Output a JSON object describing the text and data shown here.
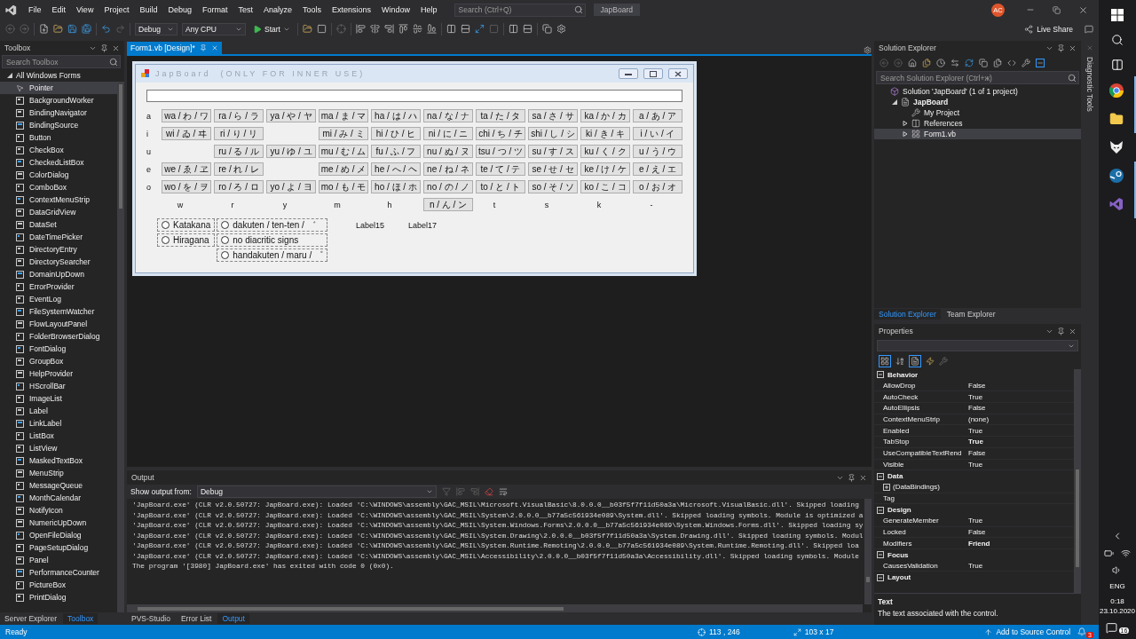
{
  "menu_bar": {
    "items": [
      "File",
      "Edit",
      "View",
      "Project",
      "Build",
      "Debug",
      "Format",
      "Test",
      "Analyze",
      "Tools",
      "Extensions",
      "Window",
      "Help"
    ],
    "search": {
      "placeholder": "Search (Ctrl+Q)"
    },
    "solution_name": "JapBoard",
    "avatar": "AC"
  },
  "toolbar": {
    "configuration": "Debug",
    "platform": "Any CPU",
    "start": "Start",
    "live_share": "Live Share"
  },
  "toolbox": {
    "title": "Toolbox",
    "search": {
      "placeholder": "Search Toolbox"
    },
    "group": {
      "label": "All Windows Forms",
      "expanded": true
    },
    "items": [
      {
        "label": "Pointer",
        "selected": true
      },
      {
        "label": "BackgroundWorker",
        "selected": false
      },
      {
        "label": "BindingNavigator",
        "selected": false
      },
      {
        "label": "BindingSource",
        "selected": false
      },
      {
        "label": "Button",
        "selected": false
      },
      {
        "label": "CheckBox",
        "selected": false
      },
      {
        "label": "CheckedListBox",
        "selected": false
      },
      {
        "label": "ColorDialog",
        "selected": false
      },
      {
        "label": "ComboBox",
        "selected": false
      },
      {
        "label": "ContextMenuStrip",
        "selected": false
      },
      {
        "label": "DataGridView",
        "selected": false
      },
      {
        "label": "DataSet",
        "selected": false
      },
      {
        "label": "DateTimePicker",
        "selected": false
      },
      {
        "label": "DirectoryEntry",
        "selected": false
      },
      {
        "label": "DirectorySearcher",
        "selected": false
      },
      {
        "label": "DomainUpDown",
        "selected": false
      },
      {
        "label": "ErrorProvider",
        "selected": false
      },
      {
        "label": "EventLog",
        "selected": false
      },
      {
        "label": "FileSystemWatcher",
        "selected": false
      },
      {
        "label": "FlowLayoutPanel",
        "selected": false
      },
      {
        "label": "FolderBrowserDialog",
        "selected": false
      },
      {
        "label": "FontDialog",
        "selected": false
      },
      {
        "label": "GroupBox",
        "selected": false
      },
      {
        "label": "HelpProvider",
        "selected": false
      },
      {
        "label": "HScrollBar",
        "selected": false
      },
      {
        "label": "ImageList",
        "selected": false
      },
      {
        "label": "Label",
        "selected": false
      },
      {
        "label": "LinkLabel",
        "selected": false
      },
      {
        "label": "ListBox",
        "selected": false
      },
      {
        "label": "ListView",
        "selected": false
      },
      {
        "label": "MaskedTextBox",
        "selected": false
      },
      {
        "label": "MenuStrip",
        "selected": false
      },
      {
        "label": "MessageQueue",
        "selected": false
      },
      {
        "label": "MonthCalendar",
        "selected": false
      },
      {
        "label": "NotifyIcon",
        "selected": false
      },
      {
        "label": "NumericUpDown",
        "selected": false
      },
      {
        "label": "OpenFileDialog",
        "selected": false
      },
      {
        "label": "PageSetupDialog",
        "selected": false
      },
      {
        "label": "Panel",
        "selected": false
      },
      {
        "label": "PerformanceCounter",
        "selected": false
      },
      {
        "label": "PictureBox",
        "selected": false
      },
      {
        "label": "PrintDialog",
        "selected": false
      }
    ],
    "tabs": [
      {
        "label": "Server Explorer",
        "selected": false
      },
      {
        "label": "Toolbox",
        "selected": true
      }
    ]
  },
  "designer": {
    "tab": {
      "label": "Form1.vb [Design]*",
      "selected": true
    },
    "form": {
      "title": "JapBoard  (ONLY FOR INNER USE)",
      "rows": [
        {
          "label": "a",
          "keys": [
            {
              "kind": "key",
              "text": "wa / わ / ワ"
            },
            {
              "kind": "key",
              "text": "ra / ら / ラ"
            },
            {
              "kind": "key",
              "text": "ya / や / ヤ"
            },
            {
              "kind": "key",
              "text": "ma / ま / マ"
            },
            {
              "kind": "key",
              "text": "ha / は / ハ"
            },
            {
              "kind": "key",
              "text": "na / な / ナ"
            },
            {
              "kind": "key",
              "text": "ta / た / タ"
            },
            {
              "kind": "key",
              "text": "sa / さ / サ"
            },
            {
              "kind": "key",
              "text": "ka / か / カ"
            },
            {
              "kind": "key",
              "text": "a / あ / ア"
            }
          ]
        },
        {
          "label": "i",
          "keys": [
            {
              "kind": "key",
              "text": "wi / ゐ / ヰ"
            },
            {
              "kind": "key",
              "text": "ri / り / リ"
            },
            {
              "kind": "blank"
            },
            {
              "kind": "key",
              "text": "mi / み / ミ"
            },
            {
              "kind": "key",
              "text": "hi / ひ / ヒ"
            },
            {
              "kind": "key",
              "text": "ni / に / ニ"
            },
            {
              "kind": "key",
              "text": "chi / ち / チ"
            },
            {
              "kind": "key",
              "text": "shi / し / シ"
            },
            {
              "kind": "key",
              "text": "ki / き / キ"
            },
            {
              "kind": "key",
              "text": "i / い / イ"
            }
          ]
        },
        {
          "label": "u",
          "keys": [
            {
              "kind": "blank"
            },
            {
              "kind": "key",
              "text": "ru / る / ル"
            },
            {
              "kind": "key",
              "text": "yu / ゆ / ユ"
            },
            {
              "kind": "key",
              "text": "mu / む / ム"
            },
            {
              "kind": "key",
              "text": "fu / ふ / フ"
            },
            {
              "kind": "key",
              "text": "nu / ぬ / ヌ"
            },
            {
              "kind": "key",
              "text": "tsu / つ / ツ"
            },
            {
              "kind": "key",
              "text": "su / す / ス"
            },
            {
              "kind": "key",
              "text": "ku / く / ク"
            },
            {
              "kind": "key",
              "text": "u / う / ウ"
            }
          ]
        },
        {
          "label": "e",
          "keys": [
            {
              "kind": "key",
              "text": "we / ゑ / ヱ"
            },
            {
              "kind": "key",
              "text": "re / れ / レ"
            },
            {
              "kind": "blank"
            },
            {
              "kind": "key",
              "text": "me / め / メ"
            },
            {
              "kind": "key",
              "text": "he / へ / ヘ"
            },
            {
              "kind": "key",
              "text": "ne / ね / ネ"
            },
            {
              "kind": "key",
              "text": "te / て / テ"
            },
            {
              "kind": "key",
              "text": "se / せ / セ"
            },
            {
              "kind": "key",
              "text": "ke / け / ケ"
            },
            {
              "kind": "key",
              "text": "e / え / エ"
            }
          ]
        },
        {
          "label": "o",
          "keys": [
            {
              "kind": "key",
              "text": "wo / を / ヲ"
            },
            {
              "kind": "key",
              "text": "ro / ろ / ロ"
            },
            {
              "kind": "key",
              "text": "yo / よ / ヨ"
            },
            {
              "kind": "key",
              "text": "mo / も / モ"
            },
            {
              "kind": "key",
              "text": "ho / ほ / ホ"
            },
            {
              "kind": "key",
              "text": "no / の / ノ"
            },
            {
              "kind": "key",
              "text": "to / と / ト"
            },
            {
              "kind": "key",
              "text": "so / そ / ソ"
            },
            {
              "kind": "key",
              "text": "ko / こ / コ"
            },
            {
              "kind": "key",
              "text": "o / お / オ"
            }
          ]
        }
      ],
      "consonants": [
        {
          "kind": "label",
          "text": "w"
        },
        {
          "kind": "label",
          "text": "r"
        },
        {
          "kind": "label",
          "text": "y"
        },
        {
          "kind": "label",
          "text": "m"
        },
        {
          "kind": "label",
          "text": "h"
        },
        {
          "kind": "key",
          "text": "n / ん / ン"
        },
        {
          "kind": "label",
          "text": "t"
        },
        {
          "kind": "label",
          "text": "s"
        },
        {
          "kind": "label",
          "text": "k"
        },
        {
          "kind": "label",
          "text": "-"
        }
      ],
      "script_options": [
        {
          "label": "Katakana",
          "selected": false
        },
        {
          "label": "Hiragana",
          "selected": false
        }
      ],
      "diacritic_options": [
        {
          "label": "dakuten / ten-ten / ゛",
          "selected": false
        },
        {
          "label": "no diacritic signs",
          "selected": false
        },
        {
          "label": "handakuten / maru / ゜",
          "selected": false
        }
      ],
      "labels": [
        "Label15",
        "Label17"
      ]
    }
  },
  "output": {
    "title": "Output",
    "source_label": "Show output from:",
    "source": "Debug",
    "lines": [
      "'JapBoard.exe' (CLR v2.0.50727: JapBoard.exe): Loaded 'C:\\WINDOWS\\assembly\\GAC_MSIL\\Microsoft.VisualBasic\\8.0.0.0__b03f5f7f11d50a3a\\Microsoft.VisualBasic.dll'. Skipped loading",
      "'JapBoard.exe' (CLR v2.0.50727: JapBoard.exe): Loaded 'C:\\WINDOWS\\assembly\\GAC_MSIL\\System\\2.0.0.0__b77a5c561934e089\\System.dll'. Skipped loading symbols. Module is optimized a",
      "'JapBoard.exe' (CLR v2.0.50727: JapBoard.exe): Loaded 'C:\\WINDOWS\\assembly\\GAC_MSIL\\System.Windows.Forms\\2.0.0.0__b77a5c561934e089\\System.Windows.Forms.dll'. Skipped loading sy",
      "'JapBoard.exe' (CLR v2.0.50727: JapBoard.exe): Loaded 'C:\\WINDOWS\\assembly\\GAC_MSIL\\System.Drawing\\2.0.0.0__b03f5f7f11d50a3a\\System.Drawing.dll'. Skipped loading symbols. Modul",
      "'JapBoard.exe' (CLR v2.0.50727: JapBoard.exe): Loaded 'C:\\WINDOWS\\assembly\\GAC_MSIL\\System.Runtime.Remoting\\2.0.0.0__b77a5c561934e089\\System.Runtime.Remoting.dll'. Skipped loa",
      "'JapBoard.exe' (CLR v2.0.50727: JapBoard.exe): Loaded 'C:\\WINDOWS\\assembly\\GAC_MSIL\\Accessibility\\2.0.0.0__b03f5f7f11d50a3a\\Accessibility.dll'. Skipped loading symbols. Module",
      "The program '[3980] JapBoard.exe' has exited with code 0 (0x0)."
    ],
    "tabs": [
      {
        "label": "PVS-Studio",
        "selected": false
      },
      {
        "label": "Error List",
        "selected": false
      },
      {
        "label": "Output",
        "selected": true
      }
    ]
  },
  "solution_explorer": {
    "title": "Solution Explorer",
    "search": {
      "placeholder": "Search Solution Explorer (Ctrl+ж)"
    },
    "tree": [
      {
        "label": "Solution 'JapBoard' (1 of 1 project)",
        "kind": "solution",
        "selected": false,
        "children": [
          {
            "label": "JapBoard",
            "kind": "project",
            "bold": true,
            "expanded": true,
            "selected": false,
            "children": [
              {
                "label": "My Project",
                "kind": "settings",
                "selected": false
              },
              {
                "label": "References",
                "kind": "references",
                "expanded": false,
                "selected": false
              },
              {
                "label": "Form1.vb",
                "kind": "form",
                "expanded": false,
                "selected": true
              }
            ]
          }
        ]
      }
    ],
    "tabs": [
      {
        "label": "Solution Explorer",
        "selected": true
      },
      {
        "label": "Team Explorer",
        "selected": false
      }
    ]
  },
  "properties": {
    "title": "Properties",
    "categories": [
      {
        "name": "Behavior",
        "expanded": true,
        "rows": [
          {
            "name": "AllowDrop",
            "value": "False",
            "bold": false
          },
          {
            "name": "AutoCheck",
            "value": "True",
            "bold": false
          },
          {
            "name": "AutoEllipsis",
            "value": "False",
            "bold": false
          },
          {
            "name": "ContextMenuStrip",
            "value": "(none)",
            "bold": false
          },
          {
            "name": "Enabled",
            "value": "True",
            "bold": false
          },
          {
            "name": "TabStop",
            "value": "True",
            "bold": true
          },
          {
            "name": "UseCompatibleTextRend",
            "value": "False",
            "bold": false
          },
          {
            "name": "Visible",
            "value": "True",
            "bold": false
          }
        ]
      },
      {
        "name": "Data",
        "expanded": true,
        "rows": [
          {
            "name": "(DataBindings)",
            "expanded": false
          },
          {
            "name": "Tag"
          }
        ]
      },
      {
        "name": "Design",
        "expanded": true,
        "rows": [
          {
            "name": "GenerateMember",
            "value": "True",
            "bold": false
          },
          {
            "name": "Locked",
            "value": "False",
            "bold": false
          },
          {
            "name": "Modifiers",
            "value": "Friend",
            "bold": true
          }
        ]
      },
      {
        "name": "Focus",
        "expanded": true,
        "rows": [
          {
            "name": "CausesValidation",
            "value": "True",
            "bold": false
          }
        ]
      },
      {
        "name": "Layout",
        "expanded": true
      }
    ],
    "description_title": "Text",
    "description": "The text associated with the control."
  },
  "diagnostic_tools": {
    "label": "Diagnostic Tools"
  },
  "status_bar": {
    "status": "Ready",
    "position": "113 , 246",
    "size": "103 x 17",
    "source_control": "Add to Source Control",
    "notifications": "3"
  },
  "taskbar": {
    "apps": [
      {
        "kind": "browser",
        "running": true
      },
      {
        "kind": "folder",
        "running": true
      },
      {
        "kind": "fox",
        "running": false
      },
      {
        "kind": "steam",
        "running": true
      },
      {
        "kind": "ide",
        "running": true
      }
    ],
    "language": "ENG",
    "time": "0:18",
    "date": "23.10.2020",
    "notifications": "16"
  }
}
